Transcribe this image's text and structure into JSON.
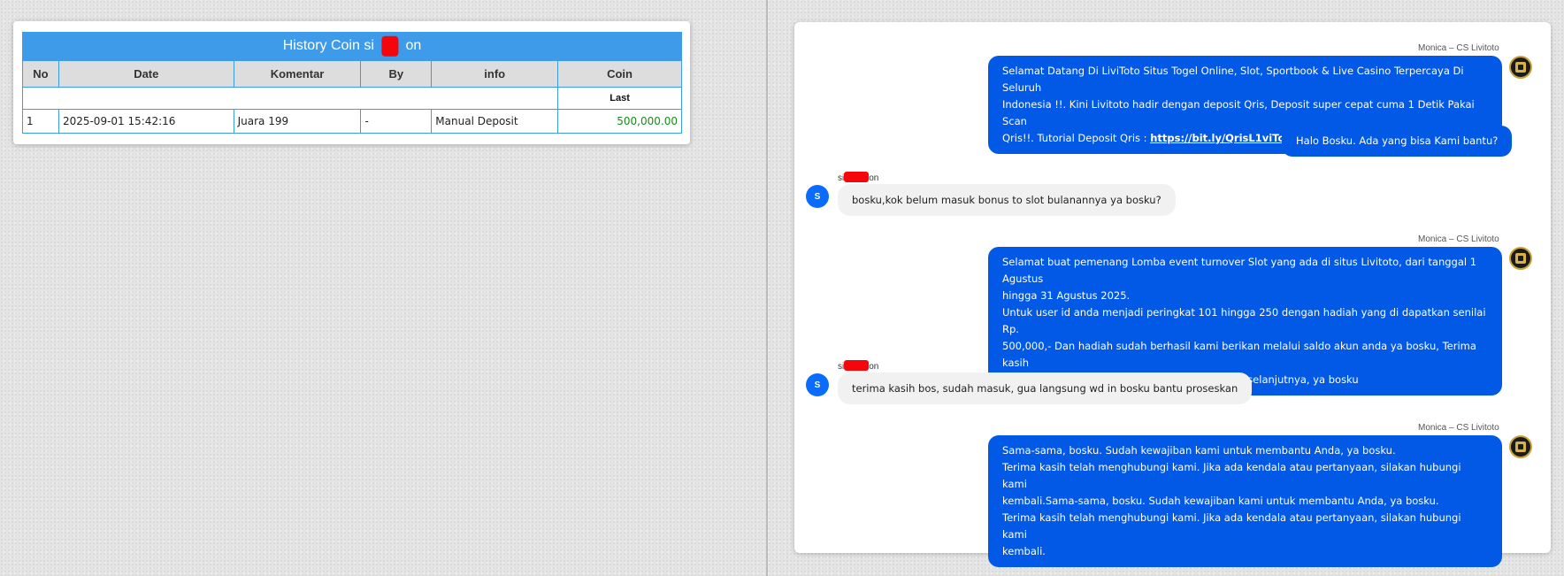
{
  "coin_history": {
    "title_prefix": "History Coin si",
    "title_suffix": "on",
    "columns": [
      "No",
      "Date",
      "Komentar",
      "By",
      "info",
      "Coin"
    ],
    "last_label": "Last",
    "rows": [
      {
        "no": "1",
        "date": "2025-09-01 15:42:16",
        "komentar": "Juara 199",
        "by": "-",
        "info": "Manual Deposit",
        "coin": "500,000.00"
      }
    ]
  },
  "chat": {
    "agent_name": "Monica – CS Livitoto",
    "user_name_prefix": "si",
    "user_name_suffix": "on",
    "user_avatar_letter": "S",
    "messages": [
      {
        "lines": [
          "Selamat Datang Di LiviToto Situs Togel Online, Slot, Sportbook & Live Casino Terpercaya Di Seluruh",
          "Indonesia !!. Kini Livitoto hadir dengan deposit Qris, Deposit super cepat cuma 1 Detik Pakai Scan",
          "Qris!!. Tutorial Deposit Qris : "
        ],
        "link": "https://bit.ly/QrisL1viTot0"
      },
      {
        "text": "Halo Bosku. Ada yang bisa Kami bantu?"
      },
      {
        "text": "bosku,kok belum masuk bonus to slot bulanannya ya bosku?"
      },
      {
        "lines": [
          "Selamat buat pemenang Lomba event turnover Slot yang ada di situs Livitoto, dari tanggal 1 Agustus",
          "hingga 31 Agustus 2025.",
          "Untuk user id anda menjadi peringkat 101 hingga 250 dengan hadiah yang di dapatkan senilai Rp.",
          "500,000,- Dan hadiah sudah berhasil kami berikan melalui saldo akun anda ya bosku, Terima kasih",
          "atas partisipasinya, dan sampai jumpa di event selanjutnya, ya bosku"
        ]
      },
      {
        "text": "terima kasih bos, sudah masuk, gua langsung wd in bosku bantu proseskan"
      },
      {
        "lines": [
          "Sama-sama, bosku. Sudah kewajiban kami untuk membantu Anda, ya bosku.",
          "Terima kasih telah menghubungi kami. Jika ada kendala atau pertanyaan, silakan hubungi kami",
          "kembali.Sama-sama, bosku. Sudah kewajiban kami untuk membantu Anda, ya bosku.",
          "Terima kasih telah menghubungi kami. Jika ada kendala atau pertanyaan, silakan hubungi kami",
          "kembali."
        ]
      }
    ]
  },
  "colors": {
    "header_blue": "#3d9be9",
    "agent_bubble": "#0259e6",
    "user_bubble": "#f1f1f1",
    "coin_green": "#1a8a1a",
    "redaction_red": "#f5060c"
  }
}
